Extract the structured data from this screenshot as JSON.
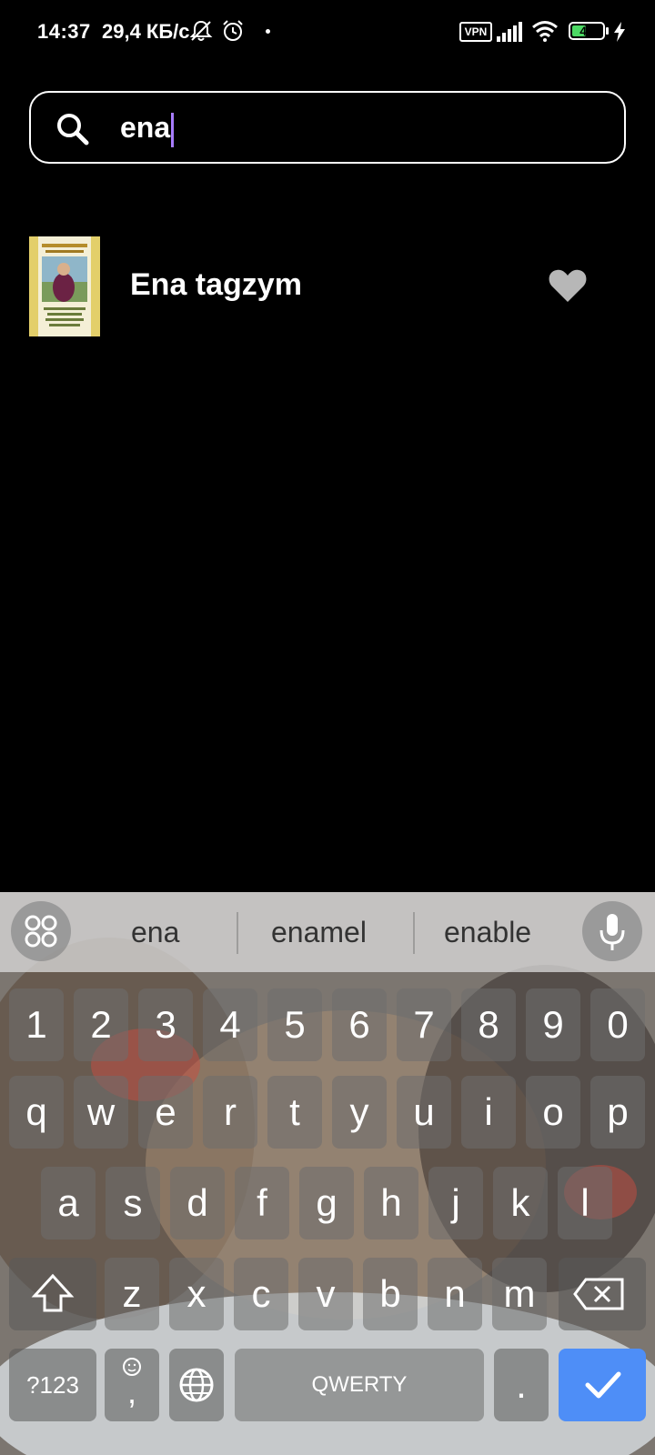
{
  "status_bar": {
    "time": "14:37",
    "speed": "29,4 КБ/с",
    "vpn": "VPN",
    "battery": "46",
    "battery_level": 0.46,
    "icons": [
      "mute-icon",
      "alarm-icon",
      "notification-dot",
      "vpn-icon",
      "signal-icon",
      "wifi-icon",
      "battery-icon",
      "charging-icon"
    ]
  },
  "search": {
    "query": "ena",
    "icon": "search-icon"
  },
  "results": [
    {
      "title": "Ena tagzym",
      "favorite": true,
      "favorite_color": "#b7b7b7"
    }
  ],
  "keyboard": {
    "suggestions": [
      "ena",
      "enamel",
      "enable"
    ],
    "row_numbers": [
      "1",
      "2",
      "3",
      "4",
      "5",
      "6",
      "7",
      "8",
      "9",
      "0"
    ],
    "row1": [
      "q",
      "w",
      "e",
      "r",
      "t",
      "y",
      "u",
      "i",
      "o",
      "p"
    ],
    "row2": [
      "a",
      "s",
      "d",
      "f",
      "g",
      "h",
      "j",
      "k",
      "l"
    ],
    "row3": [
      "z",
      "x",
      "c",
      "v",
      "b",
      "n",
      "m"
    ],
    "symbols_label": "?123",
    "comma_label": ",",
    "space_label": "QWERTY",
    "period_label": ".",
    "enter_color": "#4e8ef7"
  }
}
